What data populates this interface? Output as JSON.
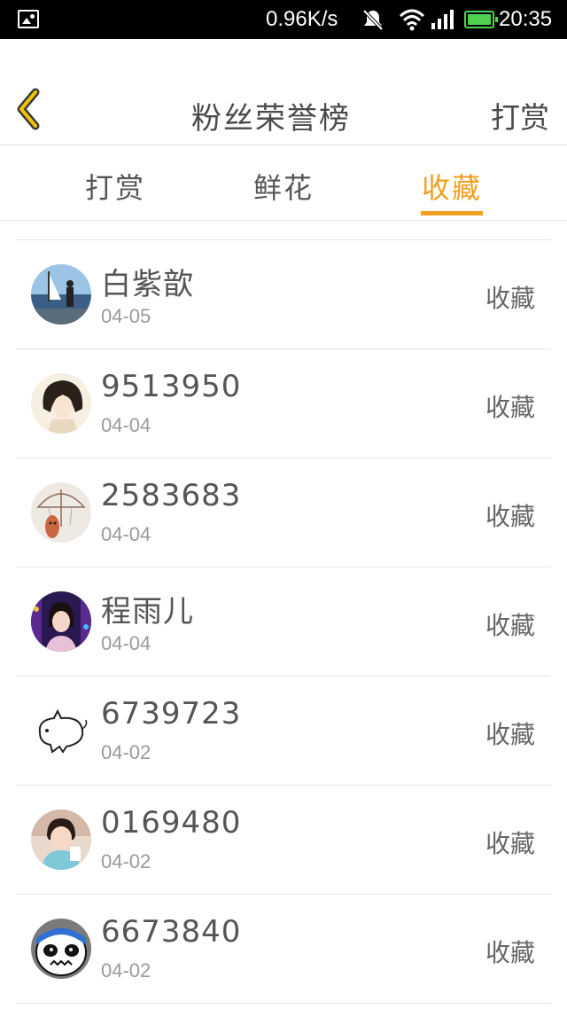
{
  "status_bar": {
    "speed": "0.96K/s",
    "time": "20:35",
    "icons": [
      "image-icon",
      "mute-icon",
      "wifi-icon",
      "signal-icon",
      "battery-icon"
    ]
  },
  "header": {
    "title": "粉丝荣誉榜",
    "action": "打赏",
    "back_icon": "chevron-left-icon",
    "accent_color": "#f0a020"
  },
  "tabs": [
    {
      "label": "打赏",
      "active": false
    },
    {
      "label": "鲜花",
      "active": false
    },
    {
      "label": "收藏",
      "active": true
    }
  ],
  "rows": [
    {
      "name": "白紫歆",
      "date": "04-05",
      "action": "收藏"
    },
    {
      "name": "9513950",
      "date": "04-04",
      "action": "收藏"
    },
    {
      "name": "2583683",
      "date": "04-04",
      "action": "收藏"
    },
    {
      "name": "程雨儿",
      "date": "04-04",
      "action": "收藏"
    },
    {
      "name": "6739723",
      "date": "04-02",
      "action": "收藏"
    },
    {
      "name": "0169480",
      "date": "04-02",
      "action": "收藏"
    },
    {
      "name": "6673840",
      "date": "04-02",
      "action": "收藏"
    }
  ]
}
